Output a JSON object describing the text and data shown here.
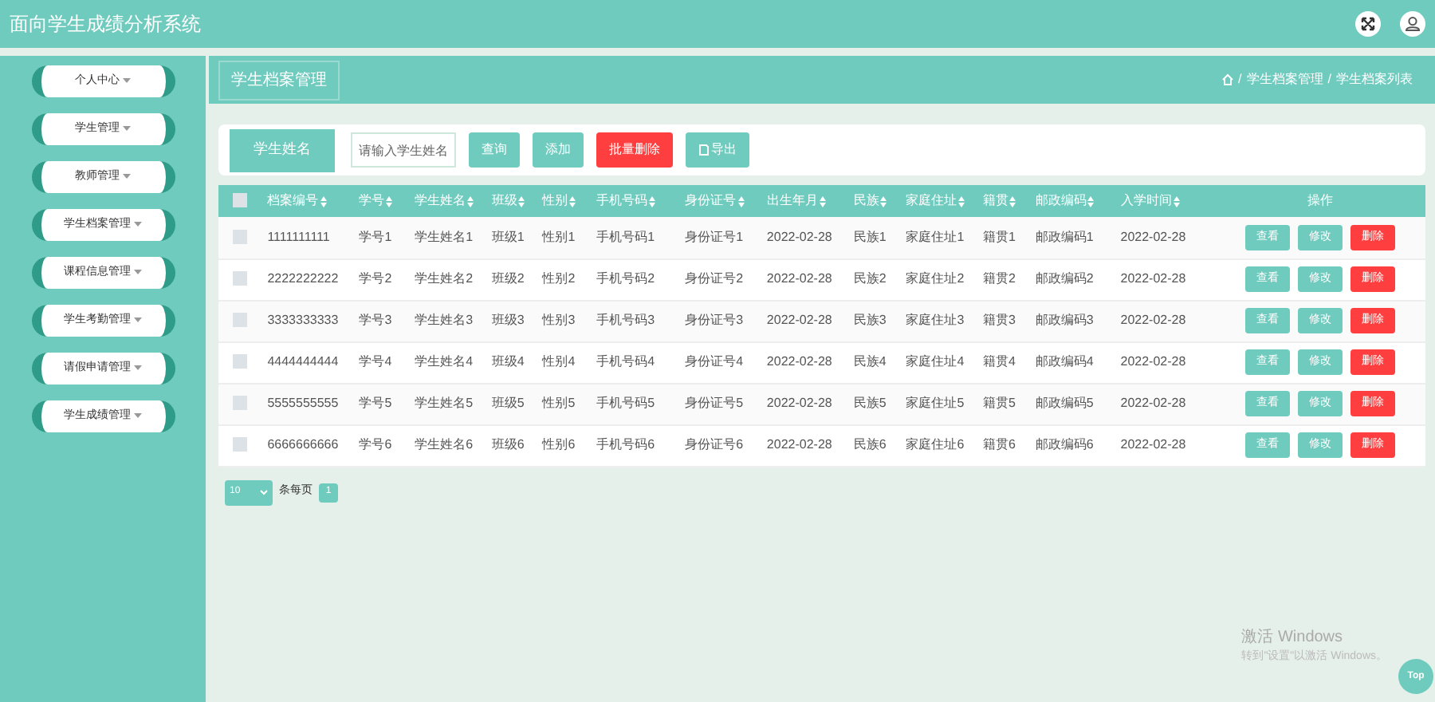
{
  "header": {
    "title": "面向学生成绩分析系统"
  },
  "sidebar": {
    "items": [
      {
        "label": "个人中心"
      },
      {
        "label": "学生管理"
      },
      {
        "label": "教师管理"
      },
      {
        "label": "学生档案管理"
      },
      {
        "label": "课程信息管理"
      },
      {
        "label": "学生考勤管理"
      },
      {
        "label": "请假申请管理"
      },
      {
        "label": "学生成绩管理"
      }
    ]
  },
  "page_tab": "学生档案管理",
  "breadcrumb": [
    {
      "separator": "/",
      "label": "学生档案管理"
    },
    {
      "separator": "/",
      "label": "学生档案列表"
    }
  ],
  "search": {
    "label": "学生姓名",
    "placeholder": "请输入学生姓名",
    "buttons": [
      {
        "label": "查询",
        "kind": "normal"
      },
      {
        "label": "添加",
        "kind": "normal"
      },
      {
        "label": "批量删除",
        "kind": "danger"
      },
      {
        "label": "导出",
        "kind": "export"
      }
    ]
  },
  "table": {
    "select_all": {
      "checked": false
    },
    "columns": [
      {
        "label": "档案编号",
        "sortable": true
      },
      {
        "label": "学号",
        "sortable": true
      },
      {
        "label": "学生姓名",
        "sortable": true
      },
      {
        "label": "班级",
        "sortable": true
      },
      {
        "label": "性别",
        "sortable": true
      },
      {
        "label": "手机号码",
        "sortable": true
      },
      {
        "label": "身份证号",
        "sortable": true
      },
      {
        "label": "出生年月",
        "sortable": true
      },
      {
        "label": "民族",
        "sortable": true
      },
      {
        "label": "家庭住址",
        "sortable": true
      },
      {
        "label": "籍贯",
        "sortable": true
      },
      {
        "label": "邮政编码",
        "sortable": true
      },
      {
        "label": "入学时间",
        "sortable": true
      },
      {
        "label": "操作",
        "sortable": false
      }
    ],
    "rows": [
      {
        "checked": false,
        "cells": [
          "1111111111",
          "学号1",
          "学生姓名1",
          "班级1",
          "性别1",
          "手机号码1",
          "身份证号1",
          "2022-02-28",
          "民族1",
          "家庭住址1",
          "籍贯1",
          "邮政编码1",
          "2022-02-28"
        ],
        "actions": [
          {
            "label": "查看",
            "kind": "normal"
          },
          {
            "label": "修改",
            "kind": "normal"
          },
          {
            "label": "删除",
            "kind": "danger"
          }
        ]
      },
      {
        "checked": false,
        "cells": [
          "2222222222",
          "学号2",
          "学生姓名2",
          "班级2",
          "性别2",
          "手机号码2",
          "身份证号2",
          "2022-02-28",
          "民族2",
          "家庭住址2",
          "籍贯2",
          "邮政编码2",
          "2022-02-28"
        ],
        "actions": [
          {
            "label": "查看",
            "kind": "normal"
          },
          {
            "label": "修改",
            "kind": "normal"
          },
          {
            "label": "删除",
            "kind": "danger"
          }
        ]
      },
      {
        "checked": false,
        "cells": [
          "3333333333",
          "学号3",
          "学生姓名3",
          "班级3",
          "性别3",
          "手机号码3",
          "身份证号3",
          "2022-02-28",
          "民族3",
          "家庭住址3",
          "籍贯3",
          "邮政编码3",
          "2022-02-28"
        ],
        "actions": [
          {
            "label": "查看",
            "kind": "normal"
          },
          {
            "label": "修改",
            "kind": "normal"
          },
          {
            "label": "删除",
            "kind": "danger"
          }
        ]
      },
      {
        "checked": false,
        "cells": [
          "4444444444",
          "学号4",
          "学生姓名4",
          "班级4",
          "性别4",
          "手机号码4",
          "身份证号4",
          "2022-02-28",
          "民族4",
          "家庭住址4",
          "籍贯4",
          "邮政编码4",
          "2022-02-28"
        ],
        "actions": [
          {
            "label": "查看",
            "kind": "normal"
          },
          {
            "label": "修改",
            "kind": "normal"
          },
          {
            "label": "删除",
            "kind": "danger"
          }
        ]
      },
      {
        "checked": false,
        "cells": [
          "5555555555",
          "学号5",
          "学生姓名5",
          "班级5",
          "性别5",
          "手机号码5",
          "身份证号5",
          "2022-02-28",
          "民族5",
          "家庭住址5",
          "籍贯5",
          "邮政编码5",
          "2022-02-28"
        ],
        "actions": [
          {
            "label": "查看",
            "kind": "normal"
          },
          {
            "label": "修改",
            "kind": "normal"
          },
          {
            "label": "删除",
            "kind": "danger"
          }
        ]
      },
      {
        "checked": false,
        "cells": [
          "6666666666",
          "学号6",
          "学生姓名6",
          "班级6",
          "性别6",
          "手机号码6",
          "身份证号6",
          "2022-02-28",
          "民族6",
          "家庭住址6",
          "籍贯6",
          "邮政编码6",
          "2022-02-28"
        ],
        "actions": [
          {
            "label": "查看",
            "kind": "normal"
          },
          {
            "label": "修改",
            "kind": "normal"
          },
          {
            "label": "删除",
            "kind": "danger"
          }
        ]
      }
    ]
  },
  "pagination": {
    "page_size": "10",
    "page_size_label": "条每页",
    "pages": [
      {
        "label": "1",
        "selected": true
      }
    ]
  },
  "os_notice": {
    "title": "激活 Windows",
    "text": "转到\"设置\"以激活 Windows。"
  },
  "top_button": "Top"
}
